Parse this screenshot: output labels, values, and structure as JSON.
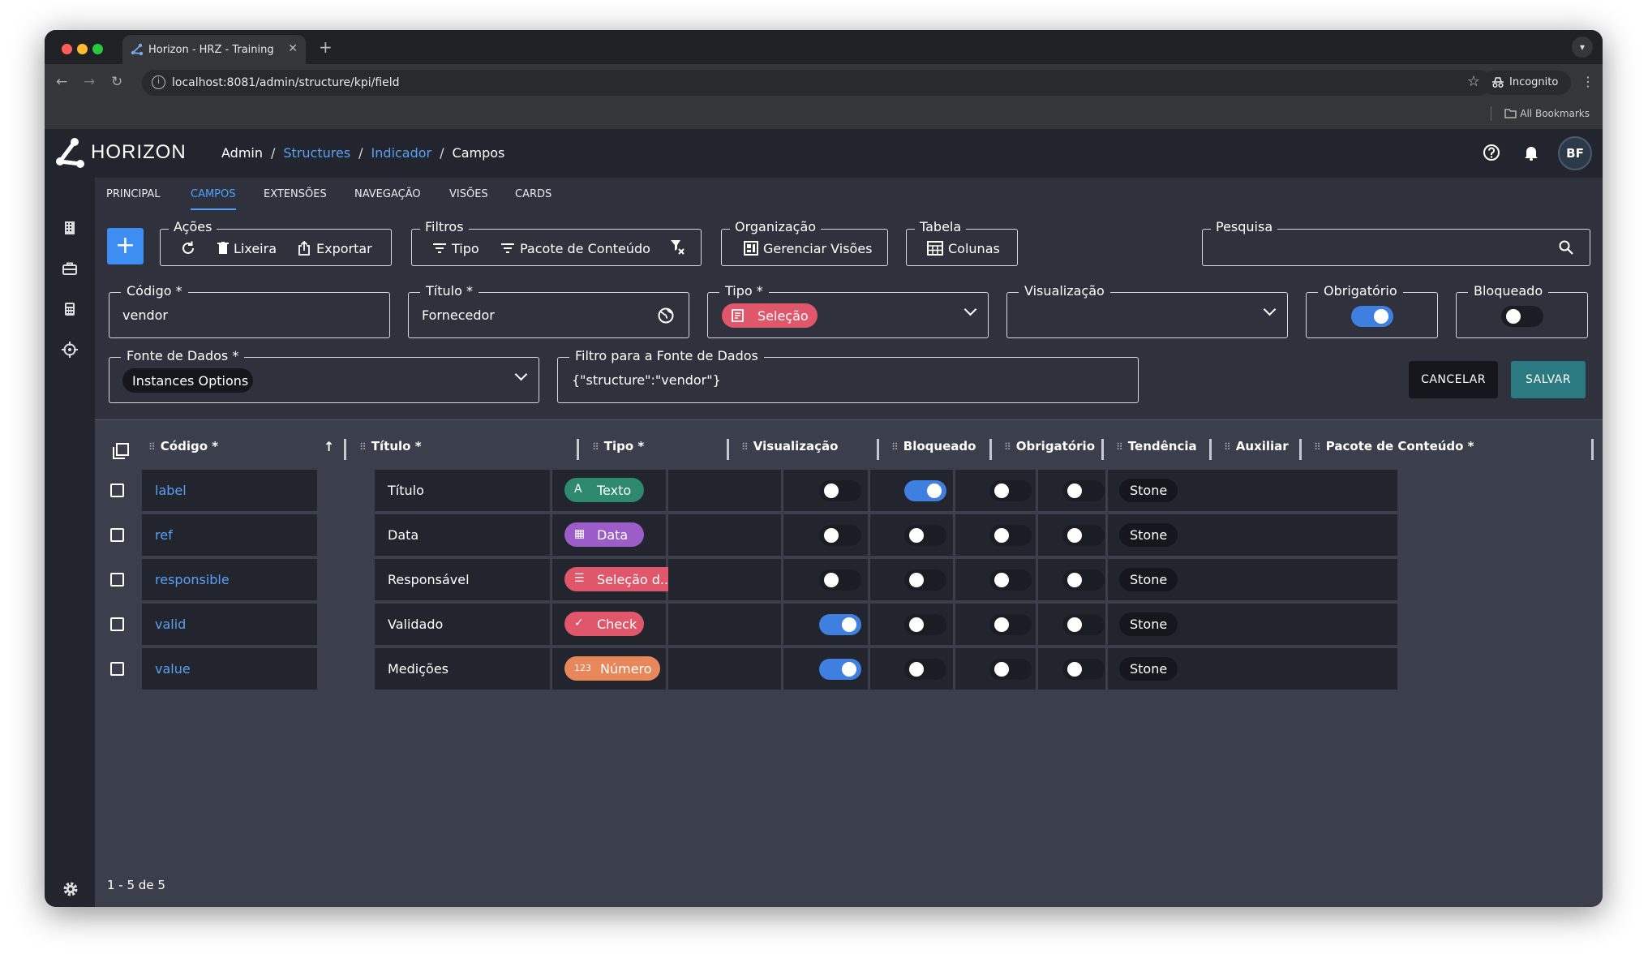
{
  "browser": {
    "tab_title": "Horizon - HRZ - Training",
    "new_tab": "+",
    "url": "localhost:8081/admin/structure/kpi/field",
    "incognito": "Incognito",
    "all_bookmarks": "All Bookmarks"
  },
  "app": {
    "logo_text": "HORIZON",
    "breadcrumb": [
      "Admin",
      "Structures",
      "Indicador",
      "Campos"
    ],
    "avatar": "BF"
  },
  "tabs": [
    "PRINCIPAL",
    "CAMPOS",
    "EXTENSÕES",
    "NAVEGAÇÃO",
    "VISÕES",
    "CARDS"
  ],
  "toolbar": {
    "acoes_label": "Ações",
    "lixeira": "Lixeira",
    "exportar": "Exportar",
    "filtros_label": "Filtros",
    "tipo": "Tipo",
    "pacote": "Pacote de Conteúdo",
    "organizacao_label": "Organização",
    "gerenciar": "Gerenciar Visões",
    "tabela_label": "Tabela",
    "colunas": "Colunas",
    "pesquisa_label": "Pesquisa"
  },
  "form": {
    "codigo_label": "Código *",
    "codigo_value": "vendor",
    "titulo_label": "Título *",
    "titulo_value": "Fornecedor",
    "tipo_label": "Tipo *",
    "tipo_value": "Seleção",
    "visualizacao_label": "Visualização",
    "obrigatorio_label": "Obrigatório",
    "obrigatorio_on": true,
    "bloqueado_label": "Bloqueado",
    "bloqueado_on": false,
    "fonte_label": "Fonte de Dados *",
    "fonte_value": "Instances Options",
    "filtro_label": "Filtro para a Fonte de Dados",
    "filtro_value": "{\"structure\":\"vendor\"}",
    "cancel": "CANCELAR",
    "save": "SALVAR"
  },
  "grid": {
    "columns": [
      "Código *",
      "Título *",
      "Tipo *",
      "Visualização",
      "Bloqueado",
      "Obrigatório",
      "Tendência",
      "Auxiliar",
      "Pacote de Conteúdo *"
    ],
    "sort_icon": "↑",
    "rows": [
      {
        "codigo": "label",
        "titulo": "Título",
        "tipo": "Texto",
        "tipo_icon": "A",
        "tipo_color": "#2e8a6e",
        "bloqueado": false,
        "obrigatorio": true,
        "tendencia": false,
        "auxiliar": false,
        "pacote": "Stone"
      },
      {
        "codigo": "ref",
        "titulo": "Data",
        "tipo": "Data",
        "tipo_icon": "▦",
        "tipo_color": "#9c5dc9",
        "bloqueado": false,
        "obrigatorio": false,
        "tendencia": false,
        "auxiliar": false,
        "pacote": "Stone"
      },
      {
        "codigo": "responsible",
        "titulo": "Responsável",
        "tipo": "Seleção d...",
        "tipo_icon": "☰",
        "tipo_color": "#e0566a",
        "bloqueado": false,
        "obrigatorio": false,
        "tendencia": false,
        "auxiliar": false,
        "pacote": "Stone"
      },
      {
        "codigo": "valid",
        "titulo": "Validado",
        "tipo": "Check",
        "tipo_icon": "✓",
        "tipo_color": "#e0566a",
        "bloqueado": true,
        "obrigatorio": false,
        "tendencia": false,
        "auxiliar": false,
        "pacote": "Stone"
      },
      {
        "codigo": "value",
        "titulo": "Medições",
        "tipo": "Número",
        "tipo_icon": "123",
        "tipo_color": "#e8875a",
        "bloqueado": true,
        "obrigatorio": false,
        "tendencia": false,
        "auxiliar": false,
        "pacote": "Stone"
      }
    ]
  },
  "footer": {
    "pagination": "1 - 5 de 5"
  },
  "colors": {
    "accent": "#3e8df3",
    "save": "#2b7a82",
    "selecao_chip": "#e0566a"
  }
}
